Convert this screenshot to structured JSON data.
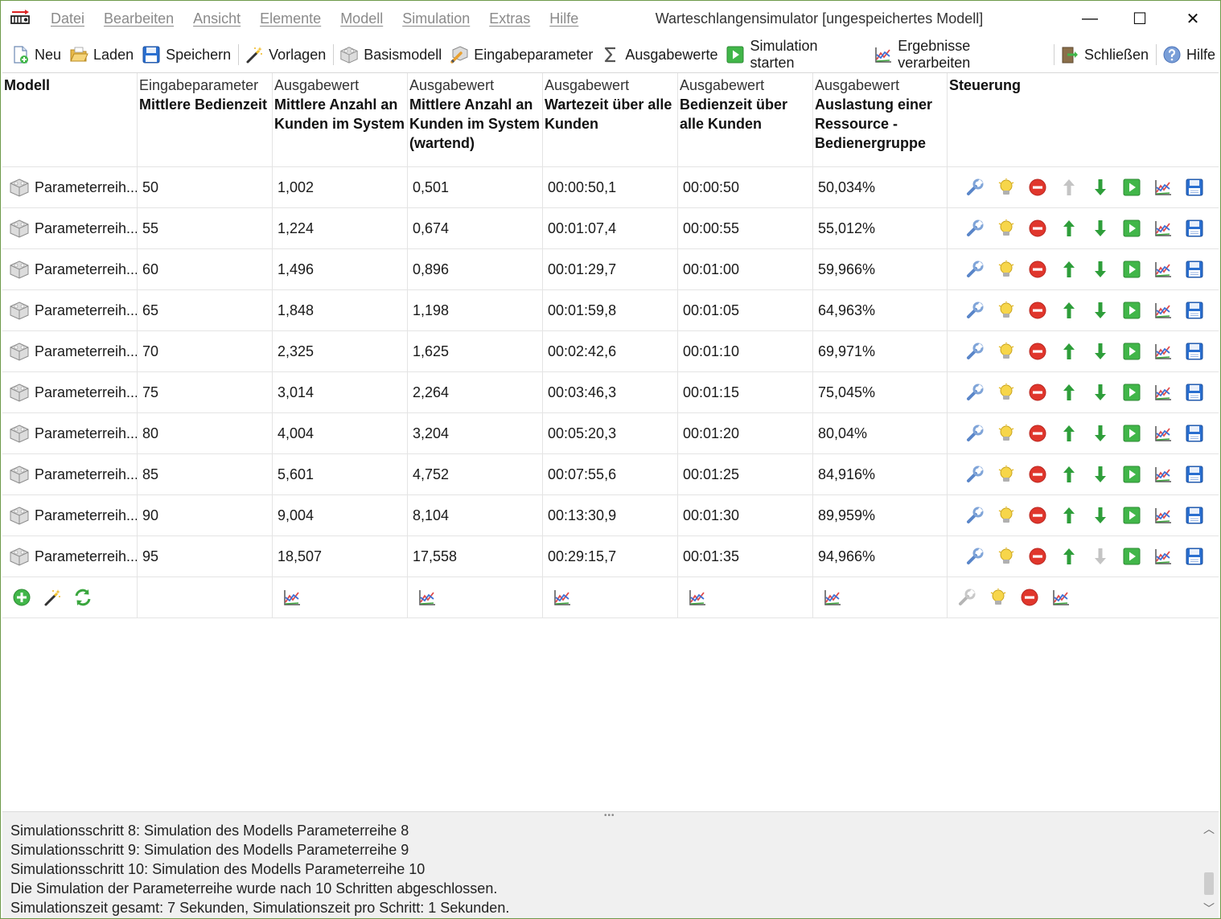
{
  "window": {
    "title": "Warteschlangensimulator [ungespeichertes Modell]",
    "controls": {
      "minimize": "—",
      "maximize": "☐",
      "close": "✕"
    }
  },
  "menu": [
    "Datei",
    "Bearbeiten",
    "Ansicht",
    "Elemente",
    "Modell",
    "Simulation",
    "Extras",
    "Hilfe"
  ],
  "toolbar": {
    "new": "Neu",
    "load": "Laden",
    "save": "Speichern",
    "templates": "Vorlagen",
    "base_model": "Basismodell",
    "input_params": "Eingabeparameter",
    "output_values": "Ausgabewerte",
    "start_sim": "Simulation starten",
    "process_results": "Ergebnisse verarbeiten",
    "close": "Schließen",
    "help": "Hilfe"
  },
  "table": {
    "headers": [
      {
        "pre": "",
        "bold": "Modell"
      },
      {
        "pre": "Eingabeparameter",
        "bold": "Mittlere Bedienzeit"
      },
      {
        "pre": "Ausgabewert",
        "bold": "Mittlere Anzahl an Kunden im System"
      },
      {
        "pre": "Ausgabewert",
        "bold": "Mittlere Anzahl an Kunden im System (wartend)"
      },
      {
        "pre": "Ausgabewert",
        "bold": "Wartezeit über alle Kunden"
      },
      {
        "pre": "Ausgabewert",
        "bold": "Bedienzeit über alle Kunden"
      },
      {
        "pre": "Ausgabewert",
        "bold": "Auslastung einer Ressource - Bedienergruppe"
      },
      {
        "pre": "",
        "bold": "Steuerung"
      }
    ],
    "rows": [
      {
        "model": "Parameterreih...",
        "service": "50",
        "n_sys": "1,002",
        "n_wait": "0,501",
        "wait": "00:00:50,1",
        "serve": "00:00:50",
        "util": "50,034%",
        "up_enabled": false,
        "down_enabled": true
      },
      {
        "model": "Parameterreih...",
        "service": "55",
        "n_sys": "1,224",
        "n_wait": "0,674",
        "wait": "00:01:07,4",
        "serve": "00:00:55",
        "util": "55,012%",
        "up_enabled": true,
        "down_enabled": true
      },
      {
        "model": "Parameterreih...",
        "service": "60",
        "n_sys": "1,496",
        "n_wait": "0,896",
        "wait": "00:01:29,7",
        "serve": "00:01:00",
        "util": "59,966%",
        "up_enabled": true,
        "down_enabled": true
      },
      {
        "model": "Parameterreih...",
        "service": "65",
        "n_sys": "1,848",
        "n_wait": "1,198",
        "wait": "00:01:59,8",
        "serve": "00:01:05",
        "util": "64,963%",
        "up_enabled": true,
        "down_enabled": true
      },
      {
        "model": "Parameterreih...",
        "service": "70",
        "n_sys": "2,325",
        "n_wait": "1,625",
        "wait": "00:02:42,6",
        "serve": "00:01:10",
        "util": "69,971%",
        "up_enabled": true,
        "down_enabled": true
      },
      {
        "model": "Parameterreih...",
        "service": "75",
        "n_sys": "3,014",
        "n_wait": "2,264",
        "wait": "00:03:46,3",
        "serve": "00:01:15",
        "util": "75,045%",
        "up_enabled": true,
        "down_enabled": true
      },
      {
        "model": "Parameterreih...",
        "service": "80",
        "n_sys": "4,004",
        "n_wait": "3,204",
        "wait": "00:05:20,3",
        "serve": "00:01:20",
        "util": "80,04%",
        "up_enabled": true,
        "down_enabled": true
      },
      {
        "model": "Parameterreih...",
        "service": "85",
        "n_sys": "5,601",
        "n_wait": "4,752",
        "wait": "00:07:55,6",
        "serve": "00:01:25",
        "util": "84,916%",
        "up_enabled": true,
        "down_enabled": true
      },
      {
        "model": "Parameterreih...",
        "service": "90",
        "n_sys": "9,004",
        "n_wait": "8,104",
        "wait": "00:13:30,9",
        "serve": "00:01:30",
        "util": "89,959%",
        "up_enabled": true,
        "down_enabled": true
      },
      {
        "model": "Parameterreih...",
        "service": "95",
        "n_sys": "18,507",
        "n_wait": "17,558",
        "wait": "00:29:15,7",
        "serve": "00:01:35",
        "util": "94,966%",
        "up_enabled": true,
        "down_enabled": false
      }
    ]
  },
  "log": [
    "Simulationsschritt 8: Simulation des Modells Parameterreihe 8",
    "Simulationsschritt 9: Simulation des Modells Parameterreihe 9",
    "Simulationsschritt 10: Simulation des Modells Parameterreihe 10",
    "Die Simulation der Parameterreihe wurde nach 10 Schritten abgeschlossen.",
    "Simulationszeit gesamt: 7 Sekunden, Simulationszeit pro Schritt: 1 Sekunden."
  ],
  "icons": {
    "row_model": "cube-icon",
    "row_controls": [
      "wrench-icon",
      "lightbulb-icon",
      "delete-icon",
      "arrow-up-icon",
      "arrow-down-icon",
      "play-icon",
      "chart-icon",
      "save-icon"
    ],
    "footer_model": [
      "add-icon",
      "magic-wand-icon",
      "refresh-icon"
    ],
    "footer_controls": [
      "wrench-icon",
      "lightbulb-icon",
      "delete-icon",
      "chart-icon"
    ]
  },
  "colors": {
    "window_border": "#6e9a4a",
    "arrow_green": "#2e9e3a",
    "disabled_gray": "#b8b8b8",
    "delete_red": "#e0362c",
    "save_blue": "#2a6fd0"
  }
}
